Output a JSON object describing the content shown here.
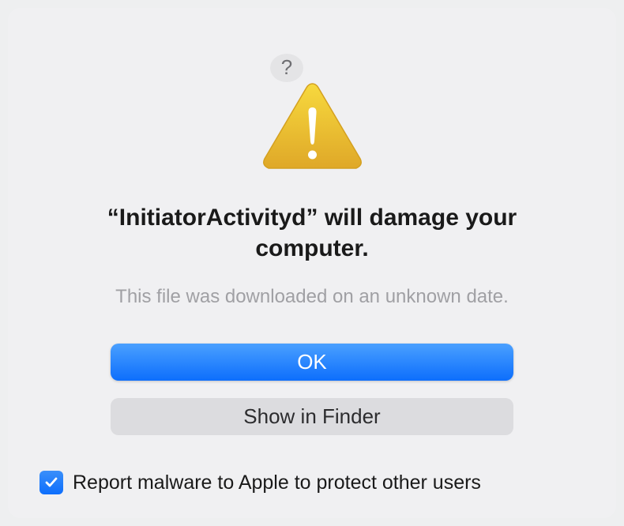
{
  "dialog": {
    "help_label": "?",
    "title_prefix": "“",
    "title_app": "InitiatorActivityd",
    "title_suffix": "” will damage your computer.",
    "subtitle": "This file was downloaded on an unknown date.",
    "ok_label": "OK",
    "show_in_finder_label": "Show in Finder",
    "checkbox_label": "Report malware to Apple to protect other users",
    "checkbox_checked": true
  },
  "colors": {
    "primary_button": "#0d6efc",
    "secondary_button": "#dcdcdf",
    "background": "#f0f0f2"
  }
}
